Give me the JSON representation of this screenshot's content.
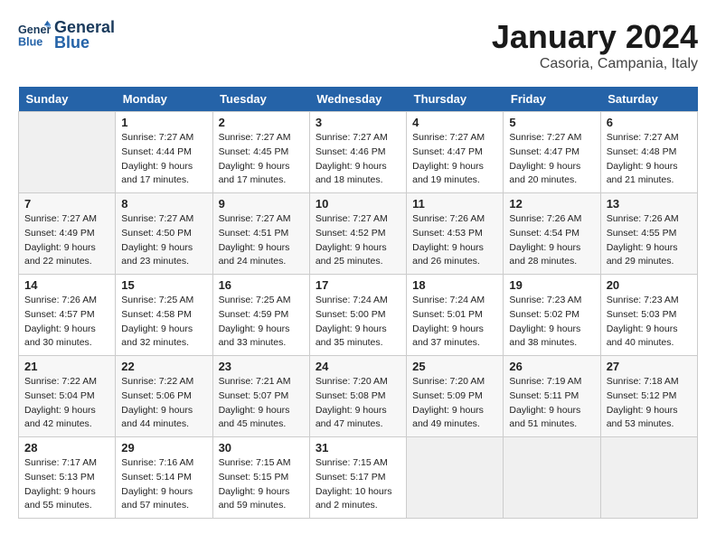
{
  "header": {
    "logo_text_general": "General",
    "logo_text_blue": "Blue",
    "month_title": "January 2024",
    "location": "Casoria, Campania, Italy"
  },
  "days_of_week": [
    "Sunday",
    "Monday",
    "Tuesday",
    "Wednesday",
    "Thursday",
    "Friday",
    "Saturday"
  ],
  "weeks": [
    [
      {
        "day": "",
        "info": ""
      },
      {
        "day": "1",
        "info": "Sunrise: 7:27 AM\nSunset: 4:44 PM\nDaylight: 9 hours\nand 17 minutes."
      },
      {
        "day": "2",
        "info": "Sunrise: 7:27 AM\nSunset: 4:45 PM\nDaylight: 9 hours\nand 17 minutes."
      },
      {
        "day": "3",
        "info": "Sunrise: 7:27 AM\nSunset: 4:46 PM\nDaylight: 9 hours\nand 18 minutes."
      },
      {
        "day": "4",
        "info": "Sunrise: 7:27 AM\nSunset: 4:47 PM\nDaylight: 9 hours\nand 19 minutes."
      },
      {
        "day": "5",
        "info": "Sunrise: 7:27 AM\nSunset: 4:47 PM\nDaylight: 9 hours\nand 20 minutes."
      },
      {
        "day": "6",
        "info": "Sunrise: 7:27 AM\nSunset: 4:48 PM\nDaylight: 9 hours\nand 21 minutes."
      }
    ],
    [
      {
        "day": "7",
        "info": "Sunrise: 7:27 AM\nSunset: 4:49 PM\nDaylight: 9 hours\nand 22 minutes."
      },
      {
        "day": "8",
        "info": "Sunrise: 7:27 AM\nSunset: 4:50 PM\nDaylight: 9 hours\nand 23 minutes."
      },
      {
        "day": "9",
        "info": "Sunrise: 7:27 AM\nSunset: 4:51 PM\nDaylight: 9 hours\nand 24 minutes."
      },
      {
        "day": "10",
        "info": "Sunrise: 7:27 AM\nSunset: 4:52 PM\nDaylight: 9 hours\nand 25 minutes."
      },
      {
        "day": "11",
        "info": "Sunrise: 7:26 AM\nSunset: 4:53 PM\nDaylight: 9 hours\nand 26 minutes."
      },
      {
        "day": "12",
        "info": "Sunrise: 7:26 AM\nSunset: 4:54 PM\nDaylight: 9 hours\nand 28 minutes."
      },
      {
        "day": "13",
        "info": "Sunrise: 7:26 AM\nSunset: 4:55 PM\nDaylight: 9 hours\nand 29 minutes."
      }
    ],
    [
      {
        "day": "14",
        "info": "Sunrise: 7:26 AM\nSunset: 4:57 PM\nDaylight: 9 hours\nand 30 minutes."
      },
      {
        "day": "15",
        "info": "Sunrise: 7:25 AM\nSunset: 4:58 PM\nDaylight: 9 hours\nand 32 minutes."
      },
      {
        "day": "16",
        "info": "Sunrise: 7:25 AM\nSunset: 4:59 PM\nDaylight: 9 hours\nand 33 minutes."
      },
      {
        "day": "17",
        "info": "Sunrise: 7:24 AM\nSunset: 5:00 PM\nDaylight: 9 hours\nand 35 minutes."
      },
      {
        "day": "18",
        "info": "Sunrise: 7:24 AM\nSunset: 5:01 PM\nDaylight: 9 hours\nand 37 minutes."
      },
      {
        "day": "19",
        "info": "Sunrise: 7:23 AM\nSunset: 5:02 PM\nDaylight: 9 hours\nand 38 minutes."
      },
      {
        "day": "20",
        "info": "Sunrise: 7:23 AM\nSunset: 5:03 PM\nDaylight: 9 hours\nand 40 minutes."
      }
    ],
    [
      {
        "day": "21",
        "info": "Sunrise: 7:22 AM\nSunset: 5:04 PM\nDaylight: 9 hours\nand 42 minutes."
      },
      {
        "day": "22",
        "info": "Sunrise: 7:22 AM\nSunset: 5:06 PM\nDaylight: 9 hours\nand 44 minutes."
      },
      {
        "day": "23",
        "info": "Sunrise: 7:21 AM\nSunset: 5:07 PM\nDaylight: 9 hours\nand 45 minutes."
      },
      {
        "day": "24",
        "info": "Sunrise: 7:20 AM\nSunset: 5:08 PM\nDaylight: 9 hours\nand 47 minutes."
      },
      {
        "day": "25",
        "info": "Sunrise: 7:20 AM\nSunset: 5:09 PM\nDaylight: 9 hours\nand 49 minutes."
      },
      {
        "day": "26",
        "info": "Sunrise: 7:19 AM\nSunset: 5:11 PM\nDaylight: 9 hours\nand 51 minutes."
      },
      {
        "day": "27",
        "info": "Sunrise: 7:18 AM\nSunset: 5:12 PM\nDaylight: 9 hours\nand 53 minutes."
      }
    ],
    [
      {
        "day": "28",
        "info": "Sunrise: 7:17 AM\nSunset: 5:13 PM\nDaylight: 9 hours\nand 55 minutes."
      },
      {
        "day": "29",
        "info": "Sunrise: 7:16 AM\nSunset: 5:14 PM\nDaylight: 9 hours\nand 57 minutes."
      },
      {
        "day": "30",
        "info": "Sunrise: 7:15 AM\nSunset: 5:15 PM\nDaylight: 9 hours\nand 59 minutes."
      },
      {
        "day": "31",
        "info": "Sunrise: 7:15 AM\nSunset: 5:17 PM\nDaylight: 10 hours\nand 2 minutes."
      },
      {
        "day": "",
        "info": ""
      },
      {
        "day": "",
        "info": ""
      },
      {
        "day": "",
        "info": ""
      }
    ]
  ]
}
